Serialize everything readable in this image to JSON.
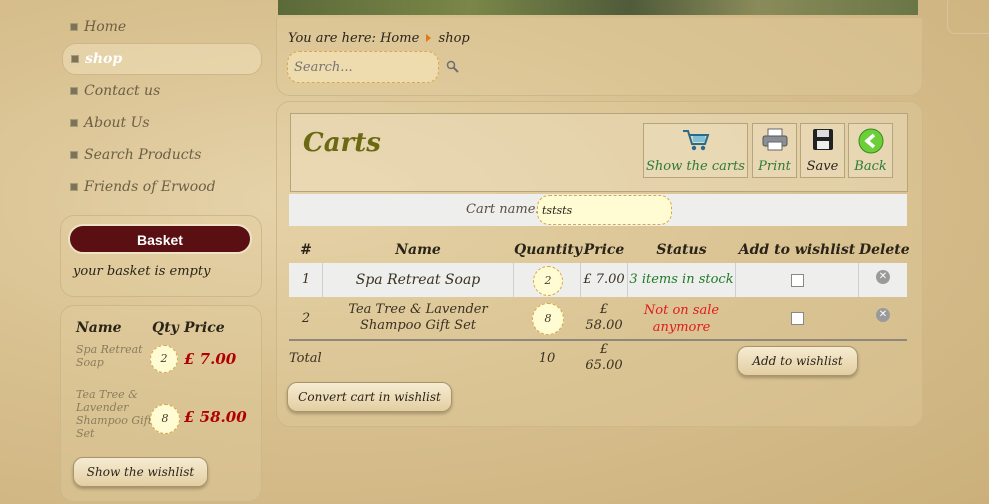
{
  "nav": {
    "items": [
      "Home",
      "shop",
      "Contact us",
      "About Us",
      "Search Products",
      "Friends of Erwood"
    ],
    "active_index": 1
  },
  "basket": {
    "button_label": "Basket",
    "empty_text": "your basket is empty",
    "columns": [
      "Name",
      "Qty",
      "Price"
    ],
    "items": [
      {
        "name": "Spa Retreat Soap",
        "qty": "2",
        "price": "£ 7.00"
      },
      {
        "name": "Tea Tree & Lavender Shampoo Gift Set",
        "qty": "8",
        "price": "£ 58.00"
      }
    ],
    "wishlist_button": "Show the wishlist"
  },
  "breadcrumb": {
    "prefix": "You are here:",
    "home": "Home",
    "current": "shop"
  },
  "search": {
    "placeholder": "Search..."
  },
  "carts": {
    "title": "Carts",
    "tools": [
      {
        "label": "Show the carts",
        "icon": "cart-icon"
      },
      {
        "label": "Print",
        "icon": "printer-icon"
      },
      {
        "label": "Save",
        "icon": "floppy-disk-icon"
      },
      {
        "label": "Back",
        "icon": "back-arrow-icon"
      }
    ],
    "cart_name_label": "Cart name:",
    "cart_name_value": "tststs",
    "columns": [
      "#",
      "Name",
      "Quantity",
      "Price",
      "Status",
      "Add to wishlist",
      "Delete"
    ],
    "rows": [
      {
        "num": "1",
        "name": "Spa Retreat Soap",
        "qty": "2",
        "price": "£ 7.00",
        "status": "3 items in stock",
        "status_color": "#1f7a2a"
      },
      {
        "num": "2",
        "name": "Tea Tree & Lavender Shampoo Gift Set",
        "qty": "8",
        "price": "£ 58.00",
        "status": "Not on sale anymore",
        "status_color": "#e01b1b"
      }
    ],
    "total_label": "Total",
    "total_qty": "10",
    "total_price": "£ 65.00",
    "add_wishlist_button": "Add to wishlist",
    "convert_button": "Convert cart in wishlist"
  },
  "colors": {
    "basket_button": "#5a0f12",
    "price_red": "#b00000",
    "title_olive": "#6b6a12",
    "tool_green": "#2e7a3a"
  }
}
